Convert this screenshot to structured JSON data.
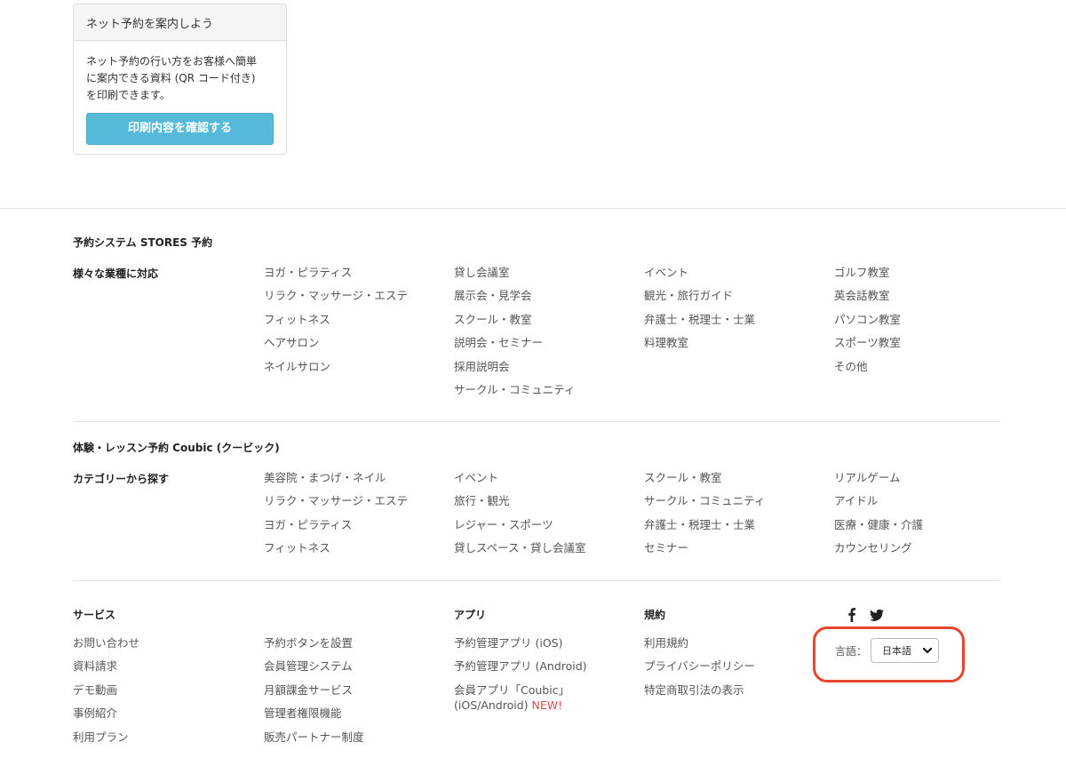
{
  "print_card": {
    "title": "ネット予約を案内しよう",
    "description_lines": [
      "ネット予約の行い方をお客様へ簡単",
      "に案内できる資料 (QR コード付き)",
      "を印刷できます。"
    ],
    "button_label": "印刷内容を確認する"
  },
  "stores": {
    "title": "予約システム STORES 予約",
    "subtitle": "様々な業種に対応",
    "columns": [
      [
        "ヨガ・ピラティス",
        "リラク・マッサージ・エステ",
        "フィットネス",
        "ヘアサロン",
        "ネイルサロン"
      ],
      [
        "貸し会議室",
        "展示会・見学会",
        "スクール・教室",
        "説明会・セミナー",
        "採用説明会",
        "サークル・コミュニティ"
      ],
      [
        "イベント",
        "観光・旅行ガイド",
        "弁護士・税理士・士業",
        "料理教室"
      ],
      [
        "ゴルフ教室",
        "英会話教室",
        "パソコン教室",
        "スポーツ教室",
        "その他"
      ]
    ]
  },
  "coubic": {
    "title": "体験・レッスン予約 Coubic (クービック)",
    "subtitle": "カテゴリーから探す",
    "columns": [
      [
        "美容院・まつげ・ネイル",
        "リラク・マッサージ・エステ",
        "ヨガ・ピラティス",
        "フィットネス"
      ],
      [
        "イベント",
        "旅行・観光",
        "レジャー・スポーツ",
        "貸しスペース・貸し会議室"
      ],
      [
        "スクール・教室",
        "サークル・コミュニティ",
        "弁護士・税理士・士業",
        "セミナー"
      ],
      [
        "リアルゲーム",
        "アイドル",
        "医療・健康・介護",
        "カウンセリング"
      ]
    ]
  },
  "footer": {
    "service_head": "サービス",
    "service_col1": [
      "お問い合わせ",
      "資料請求",
      "デモ動画",
      "事例紹介",
      "利用プラン"
    ],
    "service_col2": [
      "予約ボタンを設置",
      "会員管理システム",
      "月額課金サービス",
      "管理者権限機能",
      "販売パートナー制度"
    ],
    "app_head": "アプリ",
    "app_items": [
      "予約管理アプリ (iOS)",
      "予約管理アプリ (Android)"
    ],
    "app_member_line1": "会員アプリ「Coubic」",
    "app_member_line2": "(iOS/Android)",
    "app_new": "NEW!",
    "terms_head": "規約",
    "terms_items": [
      "利用規約",
      "プライバシーポリシー",
      "特定商取引法の表示"
    ],
    "language_label": "言語：",
    "language_value": "日本語"
  },
  "icons": {
    "facebook": "facebook-icon",
    "twitter": "twitter-icon",
    "chevron": "chevron-down-icon"
  },
  "colors": {
    "button": "#55b9d9",
    "highlight": "#e8452e",
    "new_badge": "#e24b4b"
  }
}
